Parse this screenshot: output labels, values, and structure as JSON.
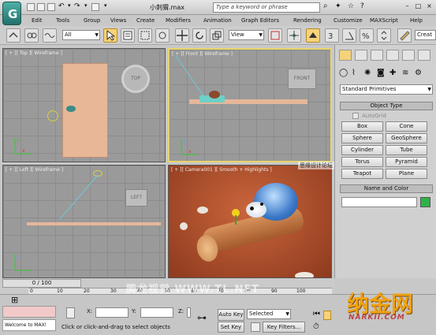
{
  "title_bar": {
    "file_name": "小刺猬.max",
    "search_placeholder": "Type a keyword or phrase"
  },
  "menu": [
    "Edit",
    "Tools",
    "Group",
    "Views",
    "Create",
    "Modifiers",
    "Animation",
    "Graph Editors",
    "Rendering",
    "Customize",
    "MAXScript",
    "Help"
  ],
  "toolbar": {
    "selection_filter": "All",
    "reference_coord": "View",
    "create_selection_set": "Creat"
  },
  "viewports": {
    "top": "[ + ][ Top ][ Wireframe ]",
    "front": "[ + ][ Front ][ Wireframe ]",
    "left": "[ + ][ Left ][ Wireframe ]",
    "camera": "[ + ][ Camera001 ][ Smooth + Highlights ]",
    "viewcube": {
      "top": "TOP",
      "front": "FRONT",
      "left": "LEFT"
    }
  },
  "command_panel": {
    "category": "Standard Primitives",
    "object_type_header": "Object Type",
    "autogrid_label": "AutoGrid",
    "object_buttons": [
      "Box",
      "Cone",
      "Sphere",
      "GeoSphere",
      "Cylinder",
      "Tube",
      "Torus",
      "Pyramid",
      "Teapot",
      "Plane"
    ],
    "name_color_header": "Name and Color",
    "object_color": "#2db34a"
  },
  "timeline": {
    "frame_counter": "0 / 100",
    "ticks": [
      "0",
      "10",
      "20",
      "30",
      "40",
      "50",
      "60",
      "70",
      "80",
      "90",
      "100"
    ]
  },
  "status": {
    "listener": "Welcome to MAX!",
    "prompt": "Click or click-and-drag to select objects",
    "x_label": "X:",
    "y_label": "Y:",
    "z_label": "Z:",
    "auto_key": "Auto Key",
    "key_mode": "Selected",
    "set_key": "Set Key",
    "key_filters": "Key Filters..."
  },
  "watermarks": {
    "top_right": "思缘设计论坛 WWW.MISSYUAN.COM",
    "bottom_center": "腾龙视觉 WWW.TL.NET",
    "logo": "纳金网",
    "logo_sub": "NARKII.COM"
  }
}
